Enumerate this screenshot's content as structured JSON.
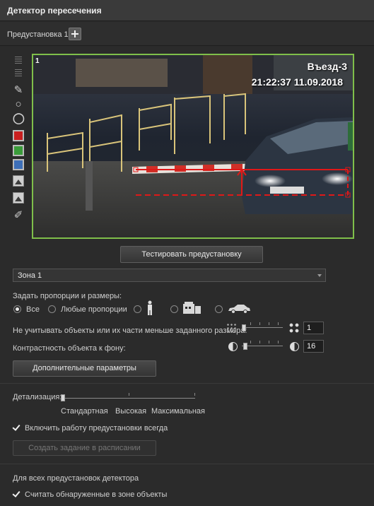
{
  "window": {
    "title": "Детектор пересечения"
  },
  "preset": {
    "label": "Предустановка 1",
    "add_icon": "plus-icon"
  },
  "toolbar": {
    "icons": [
      "grid-fine-icon",
      "grid-coarse-icon",
      "pen-icon",
      "ring-icon",
      "ring-bold-icon",
      "red-color-swatch",
      "green-color-swatch",
      "blue-color-swatch",
      "image-icon",
      "image-alt-icon",
      "brush-icon"
    ],
    "colors": {
      "red": "#c92020",
      "green": "#3a9c3a",
      "blue": "#3d6fb8"
    }
  },
  "video": {
    "camera_number": "1",
    "camera_name": "Въезд-3",
    "timestamp": "21:22:37  11.09.2018",
    "frame_color": "#7fbf4a",
    "line_color": "#e01818"
  },
  "test_button": "Тестировать предустановку",
  "zone": {
    "selected": "Зона 1"
  },
  "proportions": {
    "label": "Задать пропорции и размеры:",
    "options": [
      {
        "label": "Все",
        "selected": true
      },
      {
        "label": "Любые пропорции",
        "selected": false
      },
      {
        "label": "",
        "icon": "person-icon",
        "selected": false
      },
      {
        "label": "",
        "icon": "truck-icon",
        "selected": false
      },
      {
        "label": "",
        "icon": "car-icon",
        "selected": false
      }
    ]
  },
  "min_size": {
    "label": "Не учитывать объекты или их части меньше заданного размера:",
    "value": "1",
    "level": 0.05
  },
  "contrast": {
    "label": "Контрастность объекта к фону:",
    "value": "16",
    "level": 0.05
  },
  "extra_button": "Дополнительные параметры",
  "detail": {
    "label": "Детализация:",
    "ticks": [
      "Стандартная",
      "Высокая",
      "Максимальная"
    ],
    "level": 0
  },
  "always_enable": {
    "label": "Включить работу предустановки всегда",
    "checked": true
  },
  "schedule_button": "Создать задание в расписании",
  "all_presets": {
    "label": "Для всех предустановок детектора"
  },
  "count_objects": {
    "label": "Считать обнаруженные в зоне объекты",
    "checked": true
  }
}
